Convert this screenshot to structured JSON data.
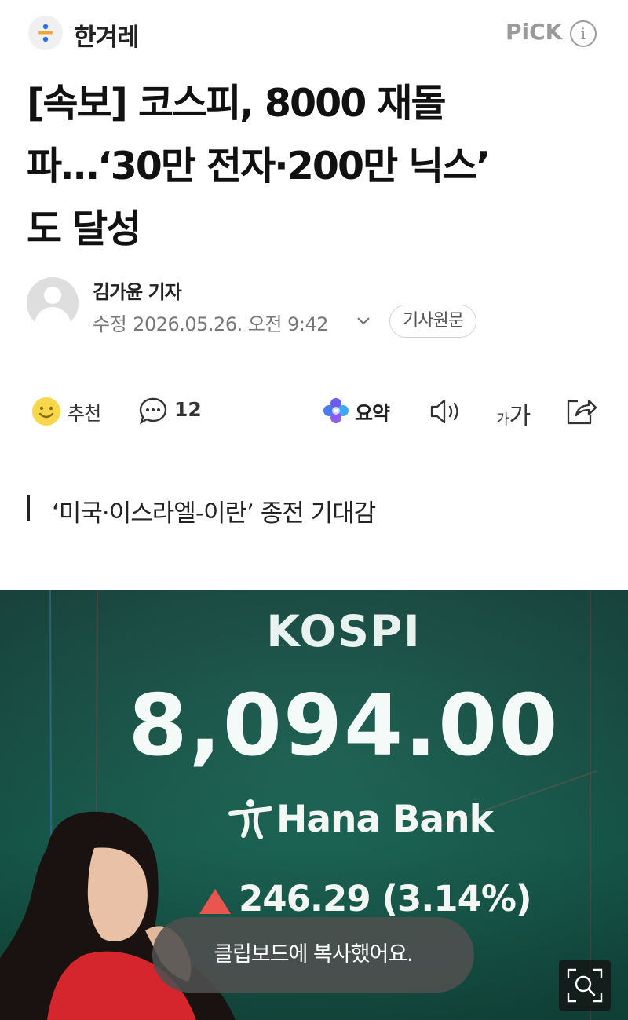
{
  "header": {
    "press_name": "한겨레",
    "pick_label": "PiCK",
    "info_symbol": "i"
  },
  "article": {
    "headline_line1": "[속보] 코스피, 8000 재돌",
    "headline_line2": "파…‘30만 전자·200만 닉스’",
    "headline_line3": "도 달성",
    "reporter": "김가윤 기자",
    "modified_label": "수정",
    "modified_datetime": "2026.05.26. 오전 9:42",
    "original_button": "기사원문",
    "subheadline": "‘미국·이스라엘-이란’ 종전 기대감"
  },
  "actions": {
    "recommend_label": "추천",
    "comment_count": "12",
    "summary_label": "요약",
    "font_small": "가",
    "font_big": "가"
  },
  "photo": {
    "board_title": "KOSPI",
    "index_value": "8,094.00",
    "bank_name": "Hana Bank",
    "change_text": "246.29 (3.14%)"
  },
  "toast": {
    "message": "클립보드에 복사했어요."
  },
  "colors": {
    "accent_icon": "#2f6fe4",
    "board_green": "#17604f",
    "up_red": "#e8564f"
  }
}
